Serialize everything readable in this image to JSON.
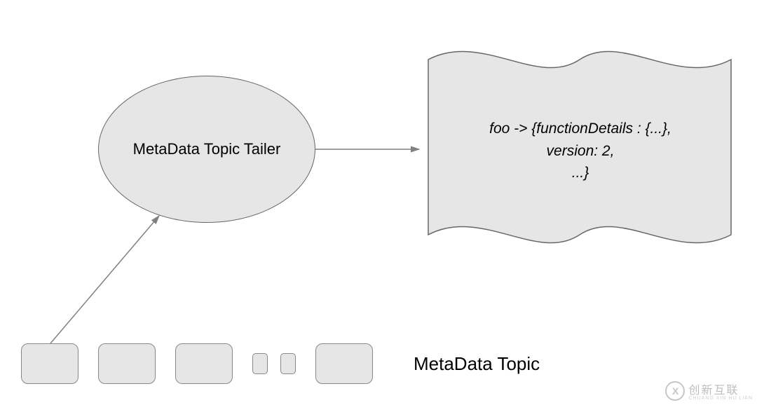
{
  "ellipse": {
    "label": "MetaData Topic Tailer"
  },
  "document": {
    "line1": "foo -> {functionDetails : {...},",
    "line2": "version: 2,",
    "line3": "...}"
  },
  "topic": {
    "label": "MetaData Topic"
  },
  "watermark": {
    "badge": "X",
    "text": "创新互联",
    "sub": "CHUANG XIN HU LIAN"
  },
  "colors": {
    "fill": "#e6e6e6",
    "stroke": "#666666"
  }
}
